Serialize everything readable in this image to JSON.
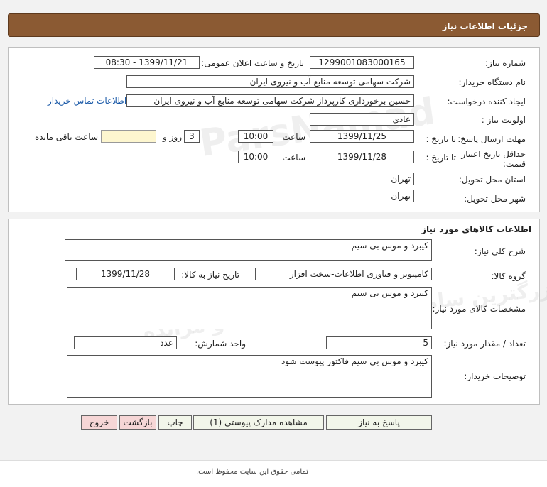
{
  "header": {
    "title": "جزئیات اطلاعات نیاز"
  },
  "info": {
    "need_number_label": "شماره نیاز:",
    "need_number": "1299001083000165",
    "announce_label": "تاریخ و ساعت اعلان عمومی:",
    "announce_value": "1399/11/21 - 08:30",
    "buyer_org_label": "نام دستگاه خریدار:",
    "buyer_org": "شرکت سهامی توسعه منابع آب و نیروی ایران",
    "creator_label": "ایجاد کننده درخواست:",
    "creator": "حسین برخورداری کارپرداز شرکت سهامی توسعه منابع آب و نیروی ایران",
    "contact_link": "اطلاعات تماس خریدار",
    "priority_label": "اولویت نیاز :",
    "priority": "عادی",
    "deadline_label": "مهلت ارسال پاسخ:",
    "until_date_label": "تا تاریخ :",
    "deadline_date": "1399/11/25",
    "time_label": "ساعت",
    "deadline_time": "10:00",
    "days_value": "3",
    "days_label": "روز و",
    "remaining_label": "ساعت باقی مانده",
    "price_validity_label": "حداقل تاریخ اعتبار قیمت:",
    "price_until_label": "تا تاریخ :",
    "price_date": "1399/11/28",
    "price_time_label": "ساعت",
    "price_time": "10:00",
    "province_label": "استان محل تحویل:",
    "province": "تهران",
    "city_label": "شهر محل تحویل:",
    "city": "تهران"
  },
  "goods": {
    "section_title": "اطلاعات کالاهای مورد نیاز",
    "general_desc_label": "شرح کلی نیاز:",
    "general_desc": "کیبرد و موس بی سیم",
    "group_label": "گروه کالا:",
    "group": "کامپیوتر و فناوری اطلاعات-سخت افزار",
    "need_date_label": "تاریخ نیاز به کالا:",
    "need_date": "1399/11/28",
    "specs_label": "مشخصات کالای مورد نیاز:",
    "specs": "کیبرد و موس بی سیم",
    "qty_label": "تعداد / مقدار مورد نیاز:",
    "qty": "5",
    "unit_label": "واحد شمارش:",
    "unit": "عدد",
    "buyer_notes_label": "توضیحات خریدار:",
    "buyer_notes": "کیبرد و موس بی سیم  فاکتور پیوست شود"
  },
  "buttons": {
    "reply": "پاسخ به نیاز",
    "attachments": "مشاهده مدارک پیوستی (1)",
    "print": "چاپ",
    "back": "بازگشت",
    "exit": "خروج"
  },
  "footer": {
    "copyright": "تمامی حقوق این سایت محفوظ است."
  }
}
